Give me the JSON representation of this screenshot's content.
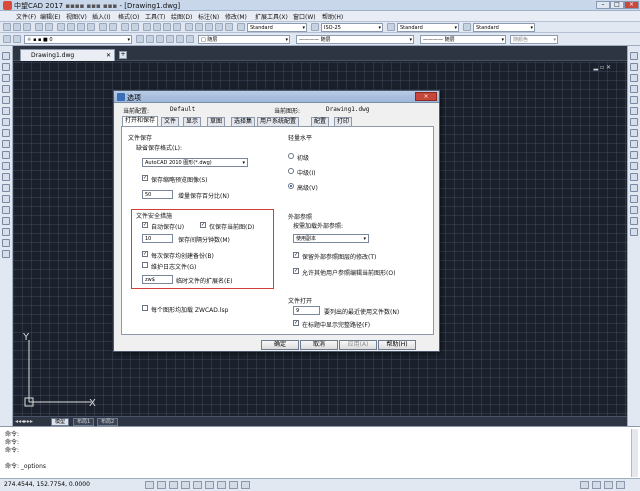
{
  "window": {
    "app_title": "中望CAD 2017",
    "file_title": "- [Drawing1.dwg]",
    "min": "–",
    "max": "□",
    "close": "×"
  },
  "menu": [
    "文件(F)",
    "编辑(E)",
    "视图(V)",
    "插入(I)",
    "格式(O)",
    "工具(T)",
    "绘图(D)",
    "标注(N)",
    "修改(M)",
    "扩展工具(X)",
    "窗口(W)",
    "帮助(H)"
  ],
  "toolbar": {
    "textstyle": "Standard",
    "dimstyle": "ISO-25",
    "tablestyle": "Standard",
    "mlstyle": "Standard",
    "layer": "0",
    "color": "随层",
    "linetype": "随层",
    "lineweight": "随层",
    "plotstyle": "随颜色"
  },
  "doc_tab": {
    "label": "Drawing1.dwg",
    "add": "+"
  },
  "layout_tabs": [
    "模型",
    "布局1",
    "布局2"
  ],
  "ucs": {
    "x": "X",
    "y": "Y"
  },
  "command_lines": [
    "命令:",
    "命令:",
    "命令:",
    "命令: _options"
  ],
  "status": {
    "coords": "274.4544, 152.7754, 0.0000"
  },
  "dialog": {
    "title": "选项",
    "close": "×",
    "current_config_label": "当前配置:",
    "current_config_value": "Default",
    "current_drawing_label": "当前图形:",
    "current_drawing_value": "Drawing1.dwg",
    "tabs": [
      "打开和保存",
      "文件",
      "显示",
      "草图",
      "选择集",
      "用户系统配置",
      "配置",
      "打印"
    ],
    "file_save": {
      "heading": "文件保存",
      "format_label": "缺省保存格式(L):",
      "format_value": "AutoCAD 2010 图形(*.dwg)",
      "thumbnail": "保存缩略预览图像(S)",
      "increment_value": "50",
      "increment_label": "增量保存百分比(N)"
    },
    "safety": {
      "heading": "文件安全措施",
      "autosave": "自动保存(U)",
      "save_current_only": "仅保存当前图(D)",
      "minutes_value": "10",
      "minutes_label": "保存间隔分钟数(M)",
      "backup": "每次保存均创建备份(B)",
      "log": "维护日志文件(G)",
      "ext_value": "zw$",
      "ext_label": "临时文件的扩展名(E)"
    },
    "load_lsp": "每个图形均加载 ZWCAD.lsp",
    "lightweight": {
      "heading": "轻量水平",
      "options": [
        "初级",
        "中级(I)",
        "高级(V)"
      ]
    },
    "xref": {
      "heading": "外部参照",
      "sub_label": "按需加载外部参照:",
      "value": "使用副本",
      "retain": "保留外部参照图层的修改(T)",
      "allow_edit": "允许其他用户参照编辑当前图形(O)"
    },
    "file_open": {
      "heading": "文件打开",
      "count_value": "9",
      "count_label": "要列出的最近使用文件数(N)",
      "full_path": "在标题中显示完整路径(F)"
    },
    "buttons": {
      "ok": "确定",
      "cancel": "取消",
      "apply": "应用(A)",
      "help": "帮助(H)"
    }
  }
}
